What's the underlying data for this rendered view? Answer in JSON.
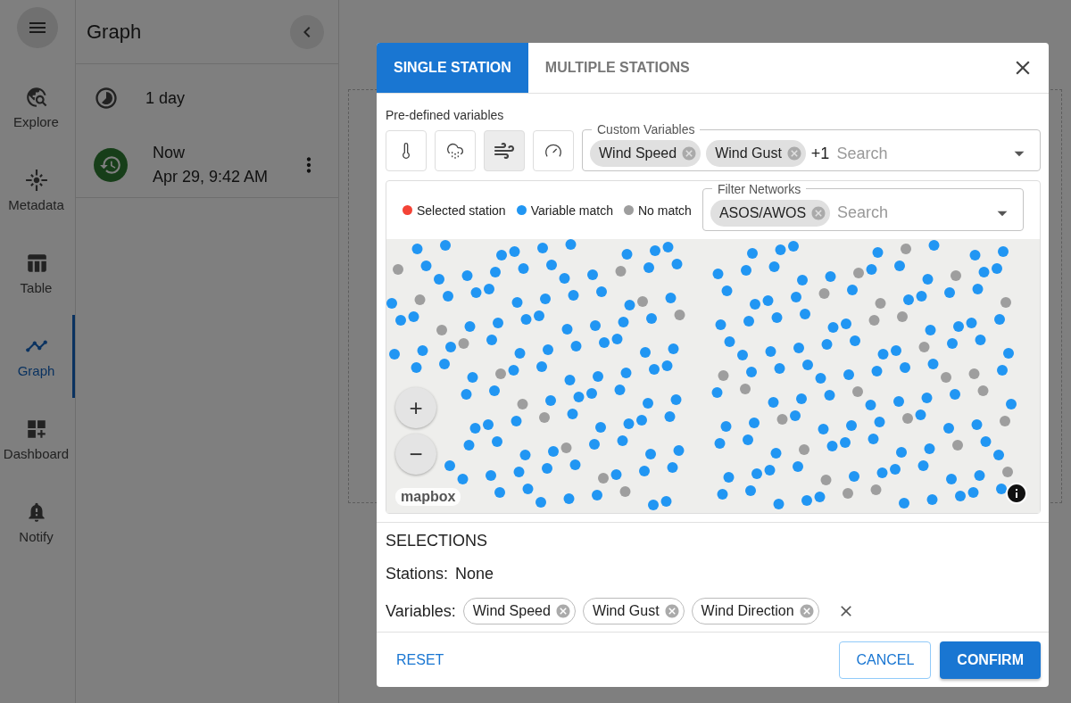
{
  "rail": [
    {
      "label": "Explore",
      "selected": false
    },
    {
      "label": "Metadata",
      "selected": false
    },
    {
      "label": "Table",
      "selected": false
    },
    {
      "label": "Graph",
      "selected": true
    },
    {
      "label": "Dashboard",
      "selected": false
    },
    {
      "label": "Notify",
      "selected": false
    }
  ],
  "panel": {
    "title": "Graph",
    "range": "1 day",
    "time_title": "Now",
    "time_date": "Apr 29, 9:42 AM"
  },
  "dialog": {
    "tabs": [
      {
        "label": "SINGLE STATION",
        "selected": true
      },
      {
        "label": "MULTIPLE STATIONS",
        "selected": false
      }
    ],
    "predefined_label": "Pre-defined variables",
    "predefined_buttons": [
      {
        "selected": false
      },
      {
        "selected": false
      },
      {
        "selected": true
      },
      {
        "selected": false
      }
    ],
    "custom_variables": {
      "label": "Custom Variables",
      "chips": [
        "Wind Speed",
        "Wind Gust"
      ],
      "more": "+1",
      "placeholder": "Search"
    },
    "legend": [
      {
        "label": "Selected station",
        "color": "#f44336"
      },
      {
        "label": "Variable match",
        "color": "#2196f3"
      },
      {
        "label": "No match",
        "color": "#9e9e9e"
      }
    ],
    "filter_networks": {
      "label": "Filter Networks",
      "chips": [
        "ASOS/AWOS"
      ],
      "placeholder": "Search"
    },
    "map": {
      "zoom_in": "+",
      "zoom_out": "−",
      "attribution": "mapbox"
    },
    "selections": {
      "title": "SELECTIONS",
      "stations_label": "Stations:",
      "stations_value": "None",
      "variables_label": "Variables:",
      "variables": [
        "Wind Speed",
        "Wind Gust",
        "Wind Direction"
      ]
    },
    "actions": {
      "reset": "RESET",
      "cancel": "CANCEL",
      "confirm": "CONFIRM"
    }
  }
}
